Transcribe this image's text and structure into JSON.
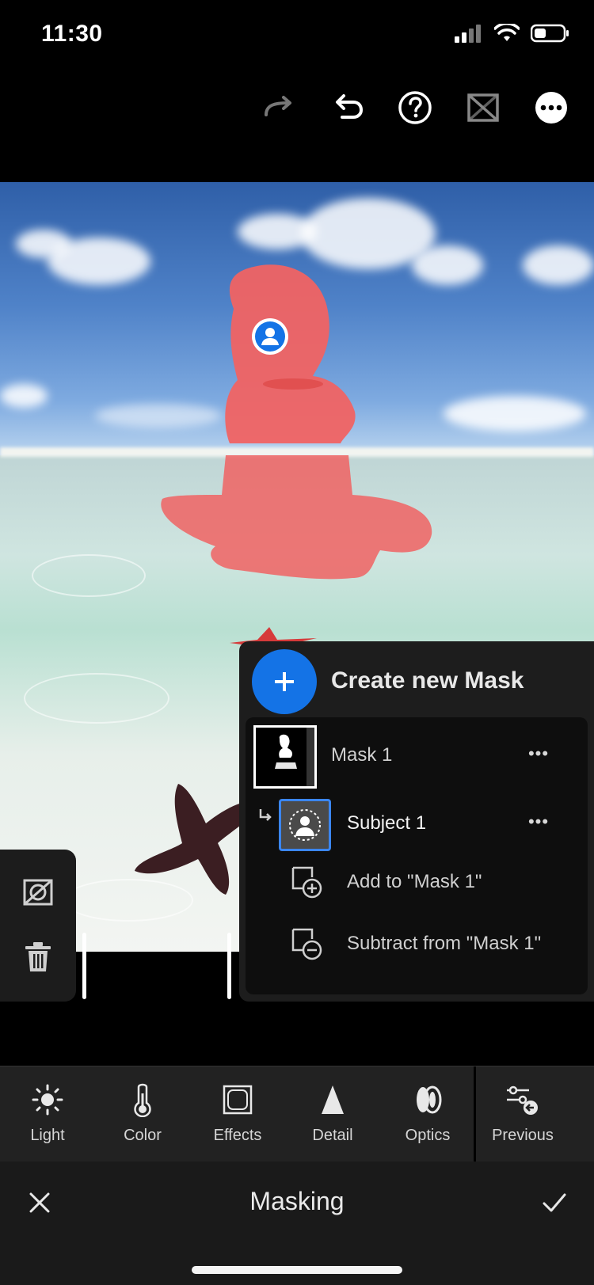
{
  "status_bar": {
    "time": "11:30"
  },
  "toolbar": {
    "icons": [
      "redo-icon",
      "undo-icon",
      "help-icon",
      "mask-overlay-toggle-icon",
      "more-icon"
    ]
  },
  "mask_panel": {
    "create_label": "Create new Mask",
    "masks": [
      {
        "name": "Mask 1",
        "components": [
          {
            "name": "Subject 1"
          }
        ]
      }
    ],
    "add_label": "Add to \"Mask 1\"",
    "subtract_label": "Subtract from \"Mask 1\""
  },
  "tools": [
    {
      "label": "Light",
      "icon": "sun-icon"
    },
    {
      "label": "Color",
      "icon": "thermometer-icon"
    },
    {
      "label": "Effects",
      "icon": "effects-frame-icon"
    },
    {
      "label": "Detail",
      "icon": "triangle-icon"
    },
    {
      "label": "Optics",
      "icon": "lens-icon"
    },
    {
      "label": "Previous",
      "icon": "previous-sliders-icon"
    }
  ],
  "footer": {
    "title": "Masking"
  },
  "colors": {
    "accent_blue": "#1473e6",
    "mask_overlay_red": "#f06363",
    "panel_bg": "#1d1d1d"
  }
}
